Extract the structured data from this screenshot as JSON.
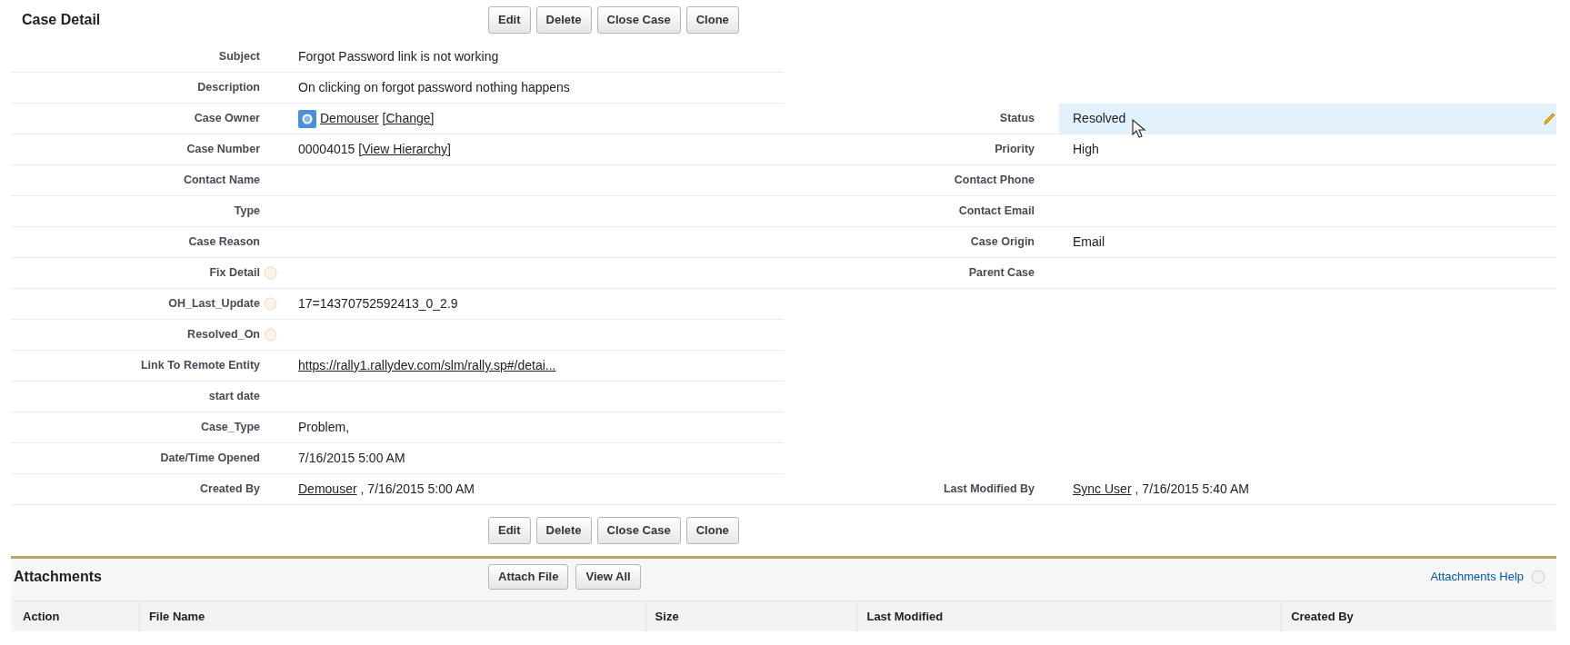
{
  "detail": {
    "title": "Case Detail",
    "buttons": [
      "Edit",
      "Delete",
      "Close Case",
      "Clone"
    ],
    "rows": [
      {
        "left": {
          "label": "Subject",
          "help": false,
          "highlighted": false,
          "value": [
            {
              "kind": "text",
              "text": "Forgot Password link is not working"
            }
          ]
        }
      },
      {
        "left": {
          "label": "Description",
          "help": false,
          "highlighted": false,
          "value": [
            {
              "kind": "text",
              "text": "On clicking on forgot password nothing happens"
            }
          ]
        }
      },
      {
        "left": {
          "label": "Case Owner",
          "help": false,
          "highlighted": false,
          "value": [
            {
              "kind": "user"
            },
            {
              "kind": "link",
              "text": "Demouser"
            },
            {
              "kind": "link",
              "text": "[Change]"
            }
          ]
        },
        "right": {
          "label": "Status",
          "help": false,
          "highlighted": true,
          "value": [
            {
              "kind": "text",
              "text": "Resolved"
            }
          ]
        }
      },
      {
        "left": {
          "label": "Case Number",
          "help": false,
          "highlighted": false,
          "value": [
            {
              "kind": "text",
              "text": "00004015"
            },
            {
              "kind": "link",
              "text": "[View Hierarchy]"
            }
          ]
        },
        "right": {
          "label": "Priority",
          "help": false,
          "highlighted": false,
          "value": [
            {
              "kind": "text",
              "text": "High"
            }
          ]
        }
      },
      {
        "left": {
          "label": "Contact Name",
          "help": false,
          "highlighted": false
        },
        "right": {
          "label": "Contact Phone",
          "help": false,
          "highlighted": false
        }
      },
      {
        "left": {
          "label": "Type",
          "help": false,
          "highlighted": false
        },
        "right": {
          "label": "Contact Email",
          "help": false,
          "highlighted": false
        }
      },
      {
        "left": {
          "label": "Case Reason",
          "help": false,
          "highlighted": false
        },
        "right": {
          "label": "Case Origin",
          "help": false,
          "highlighted": false,
          "value": [
            {
              "kind": "text",
              "text": "Email"
            }
          ]
        }
      },
      {
        "left": {
          "label": "Fix Detail",
          "help": true,
          "highlighted": false
        },
        "right": {
          "label": "Parent Case",
          "help": false,
          "highlighted": false
        }
      },
      {
        "left": {
          "label": "OH_Last_Update",
          "help": true,
          "highlighted": false,
          "value": [
            {
              "kind": "text",
              "text": "17=14370752592413_0_2.9"
            }
          ]
        }
      },
      {
        "left": {
          "label": "Resolved_On",
          "help": true,
          "highlighted": false
        }
      },
      {
        "left": {
          "label": "Link To Remote Entity",
          "help": false,
          "highlighted": false,
          "value": [
            {
              "kind": "link",
              "text": "https://rally1.rallydev.com/slm/rally.sp#/detai..."
            }
          ]
        }
      },
      {
        "left": {
          "label": "start date",
          "help": false,
          "highlighted": false
        }
      },
      {
        "left": {
          "label": "Case_Type",
          "help": false,
          "highlighted": false,
          "value": [
            {
              "kind": "text",
              "text": "Problem,"
            }
          ]
        }
      },
      {
        "left": {
          "label": "Date/Time Opened",
          "help": false,
          "highlighted": false,
          "value": [
            {
              "kind": "text",
              "text": "7/16/2015 5:00 AM"
            }
          ]
        }
      },
      {
        "left": {
          "label": "Created By",
          "help": false,
          "highlighted": false,
          "value": [
            {
              "kind": "link",
              "text": "Demouser"
            },
            {
              "kind": "text",
              "text": ", 7/16/2015 5:00 AM"
            }
          ]
        },
        "right": {
          "label": "Last Modified By",
          "help": false,
          "highlighted": false,
          "value": [
            {
              "kind": "link",
              "text": "Sync User"
            },
            {
              "kind": "text",
              "text": ", 7/16/2015 5:40 AM"
            }
          ]
        }
      }
    ],
    "bottom_buttons": [
      "Edit",
      "Delete",
      "Close Case",
      "Clone"
    ]
  },
  "attachments": {
    "title": "Attachments",
    "buttons": [
      "Attach File",
      "View All"
    ],
    "help_link": "Attachments Help",
    "columns": [
      "Action",
      "File Name",
      "Size",
      "Last Modified",
      "Created By"
    ]
  }
}
